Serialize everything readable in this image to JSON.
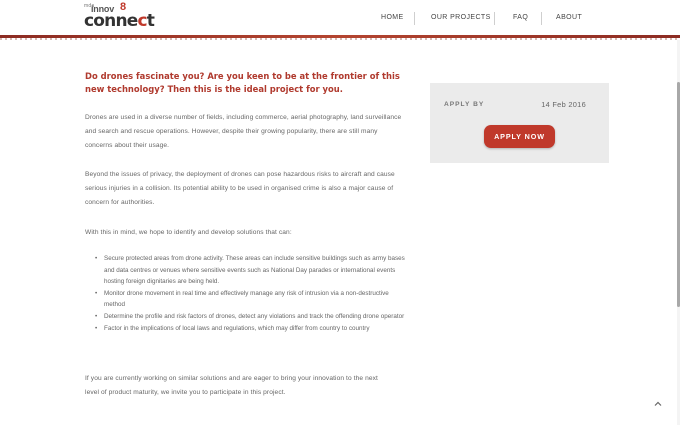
{
  "header": {
    "logo": {
      "small_text": "mda",
      "innov_text": "innov",
      "eight_text": "8",
      "connect_dark": "conne",
      "connect_red": "c",
      "connect_end": "t"
    },
    "nav": [
      {
        "label": "HOME"
      },
      {
        "label": "OUR PROJECTS"
      },
      {
        "label": "FAQ"
      },
      {
        "label": "ABOUT"
      }
    ]
  },
  "main": {
    "headline": "Do drones fascinate you? Are you keen to be at the frontier of this new technology? Then this is the ideal project for you.",
    "paragraphs": [
      "Drones are used in a diverse number of fields, including commerce, aerial photography, land surveillance and search and rescue operations. However, despite their growing popularity, there are still many concerns about their usage.",
      "Beyond the issues of privacy, the deployment of drones can pose hazardous risks to aircraft and cause serious injuries in a collision. Its potential ability to be used in organised crime is also a major cause of concern for authorities.",
      "With this in mind, we hope to identify and develop solutions that can:",
      "If you are currently working on similar solutions and are eager to bring your innovation to the next level of product maturity, we invite you to participate in this project."
    ],
    "bullets": [
      "Secure protected areas from drone activity. These areas can include sensitive buildings such as army bases and data centres or venues where sensitive events such as National Day parades or international events hosting foreign dignitaries are being held.",
      "Monitor drone movement in real time and effectively manage any risk of intrusion via a non-destructive method",
      "Determine the profile and risk factors of drones, detect any violations and track the offending drone operator",
      "Factor in the implications of local laws and regulations, which may differ from country to country"
    ]
  },
  "sidebar": {
    "apply_by_label": "APPLY BY",
    "apply_by_date": "14 Feb 2016",
    "apply_button_label": "APPLY NOW"
  },
  "icons": {
    "back_to_top": "chevron-up-icon"
  },
  "colors": {
    "accent": "#c0392b",
    "headline": "#b03a2e",
    "card_bg": "#ebebeb",
    "body_text": "#666666"
  }
}
